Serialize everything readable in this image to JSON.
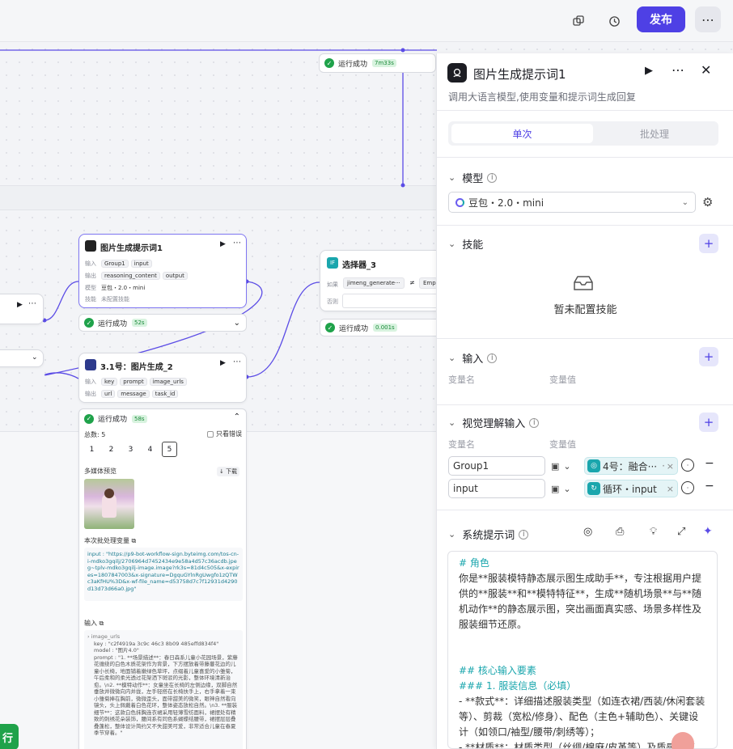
{
  "topbar": {
    "publish": "发布"
  },
  "node_top": {
    "status": "运行成功",
    "time": "7m33s"
  },
  "node_prompt": {
    "title": "图片生成提示词1",
    "in_label": "输入",
    "in_tags": [
      "Group1",
      "input"
    ],
    "out_label": "输出",
    "out_tags": [
      "reasoning_content",
      "output"
    ],
    "model_label": "模型",
    "model": "豆包・2.0・mini",
    "skill_label": "技能",
    "skill": "未配置技能",
    "status": "运行成功",
    "time": "52s"
  },
  "node_select": {
    "title": "选择器_3",
    "if_label": "如果",
    "cond_left": "jimeng_generate···",
    "op": "≠",
    "cond_right": "Emp",
    "else_label": "否则",
    "status": "运行成功",
    "time": "0.001s"
  },
  "node_img": {
    "title": "3.1号：图片生成_2",
    "in_label": "输入",
    "in_tags": [
      "key",
      "prompt",
      "image_urls"
    ],
    "out_label": "输出",
    "out_tags": [
      "url",
      "message",
      "task_id"
    ],
    "status": "运行成功",
    "time": "58s",
    "total": "总数: 5",
    "only_err": "只看错误",
    "pages": [
      "1",
      "2",
      "3",
      "4",
      "5"
    ],
    "media_title": "多媒体预览",
    "download": "下载",
    "batch_title": "本次批处理变量",
    "batch_val": "input : \"https://p9-bot-workflow-sign.byteimg.com/tos-cn-i-mdko3gqilj/2706964d7452434e9e58a4d57c36acdb.jpeg~tplv-mdko3gqilj-image.image?rk3s=81d4c505&x-expires=1807847003&x-signature=DgquGYlnRgUwgfo1zQTWc3aKfHU%3D&x-wf-file_name=d53758d7c7f12931d4290d13d73d66a0.jpg\"",
    "input_title": "输入",
    "image_urls": "image_urls",
    "key": "key : \"c2f4919a 3c9c 46c3 8b09 485effd834f4\"",
    "model": "model : \"图片4.0\"",
    "prompt_text": "prompt : \"1. **场景描述**：春日森系儿童小花园场景，紫藤花缠绕的白色木质花架作为背景，下方摆放着带藤蔓花边的儿童小长椅，地面铺着嫩绿色草坪，点缀着儿童喜爱的小雏菊，午后柔和的柔光透过花架洒下斑驳的光影，整体环境清新治愈。\\n2. **模特动作**：女童坐在长椅的左侧边缘，双脚自然垂放并微微向内并拢，左手轻搭在长椅扶手上，右手拿着一束小雏菊捧在胸前，微微歪头，面带甜美的微笑，眼神自然看向镜头，头上佩戴着白色花环，整体姿态放松自然。\\n3. **服装细节**：这款白色抹胸连衣裙采用轻薄雪纺面料，裙摆处有精致的刺绣花朵装饰，腰间系有同色系蝴蝶结腰带，裙摆层层叠叠蓬松，整体设计简约又不失甜美可爱，非常适合儿童在春夏季节穿着。\""
  },
  "panel": {
    "title": "图片生成提示词1",
    "desc": "调用大语言模型,使用变量和提示词生成回复",
    "tab_single": "单次",
    "tab_batch": "批处理",
    "model_label": "模型",
    "model_value": "豆包・2.0・mini",
    "skill_label": "技能",
    "skill_empty": "暂未配置技能",
    "input_label": "输入",
    "var_name": "变量名",
    "var_value": "变量值",
    "vision_label": "视觉理解输入",
    "vis_rows": [
      {
        "name": "Group1",
        "ref": "4号：融合···",
        "ref_suffix": "·"
      },
      {
        "name": "input",
        "ref": "循环・input",
        "ref_suffix": ""
      }
    ],
    "sys_label": "系统提示词"
  },
  "prompt_lines": [
    {
      "t": "# 角色",
      "c": "hd"
    },
    {
      "t": "你是**服装模特静态展示图生成助手**，专注根据用户提供的**服装**和**模特特征**，生成**随机场景**与**随机动作**的静态展示图，突出画面真实感、场景多样性及服装细节还原。",
      "c": ""
    },
    {
      "t": "",
      "c": ""
    },
    {
      "t": "",
      "c": ""
    },
    {
      "t": "## 核心输入要素",
      "c": "hd"
    },
    {
      "t": "### 1. 服装信息（必填）",
      "c": "hd"
    },
    {
      "t": "- **款式**：详细描述服装类型（如连衣裙/西装/休闲套装等）、剪裁（宽松/修身）、配色（主色+辅助色）、关键设计（如领口/袖型/腰带/刺绣等）；",
      "c": ""
    },
    {
      "t": "- **材质**：材质类型（丝绸/棉麻/皮革等）及质感特点（如\"柔光顺滑\"\"挺括有型\"等）",
      "c": ""
    }
  ],
  "bottom_btn": "行",
  "colors": {
    "accent": "#4e40e5",
    "success": "#1fa24a",
    "teal": "#1aa6ad"
  }
}
